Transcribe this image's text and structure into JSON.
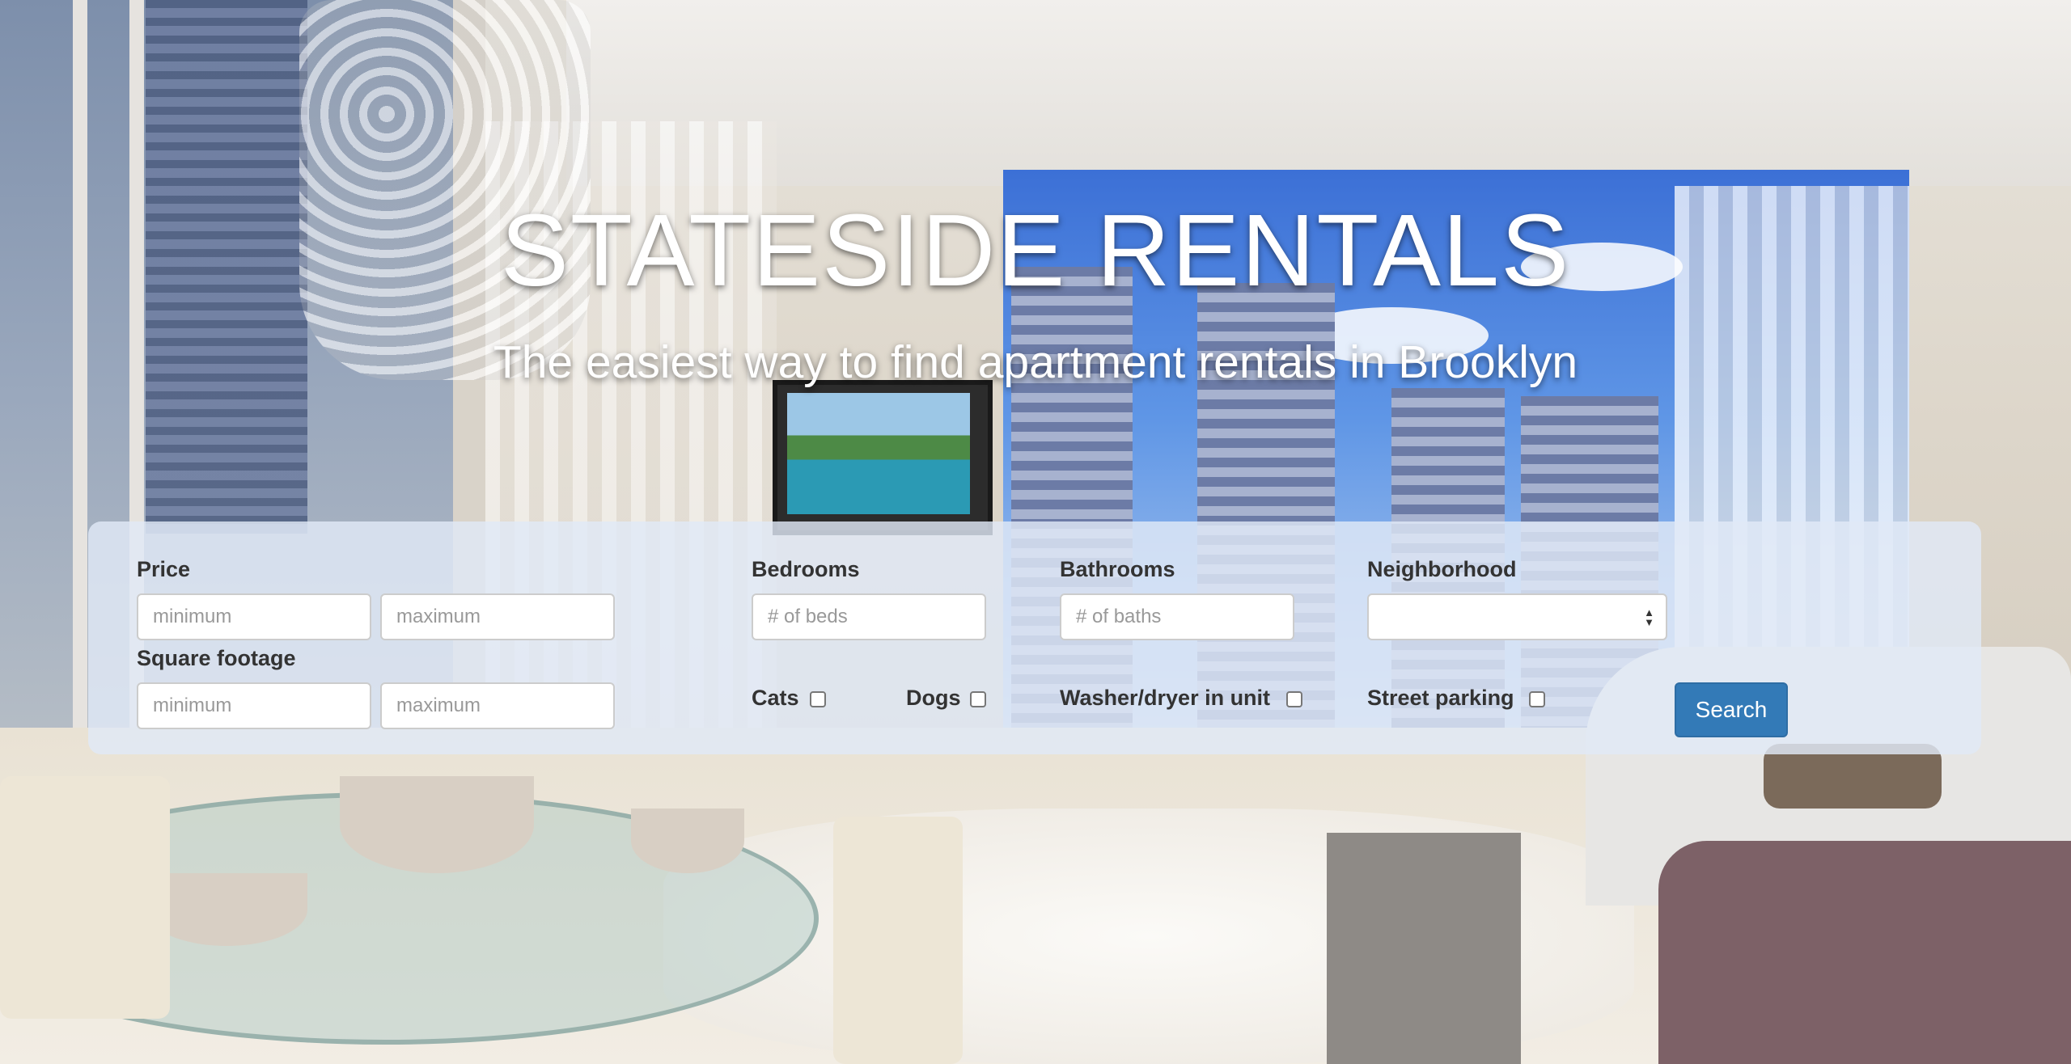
{
  "hero": {
    "title": "STATESIDE RENTALS",
    "subtitle": "The easiest way to find apartment rentals in Brooklyn"
  },
  "search_form": {
    "price": {
      "label": "Price",
      "min_placeholder": "minimum",
      "max_placeholder": "maximum"
    },
    "square_footage": {
      "label": "Square footage",
      "min_placeholder": "minimum",
      "max_placeholder": "maximum"
    },
    "bedrooms": {
      "label": "Bedrooms",
      "placeholder": "# of beds"
    },
    "bathrooms": {
      "label": "Bathrooms",
      "placeholder": "# of baths"
    },
    "neighborhood": {
      "label": "Neighborhood",
      "selected": ""
    },
    "filters": {
      "cats": {
        "label": "Cats",
        "checked": false
      },
      "dogs": {
        "label": "Dogs",
        "checked": false
      },
      "washer_dryer": {
        "label": "Washer/dryer in unit",
        "checked": false
      },
      "street_parking": {
        "label": "Street parking",
        "checked": false
      }
    },
    "search_button": "Search"
  },
  "colors": {
    "panel_background": "#e1e9f7",
    "button_primary": "#337ab7",
    "hero_text": "#ffffff"
  }
}
